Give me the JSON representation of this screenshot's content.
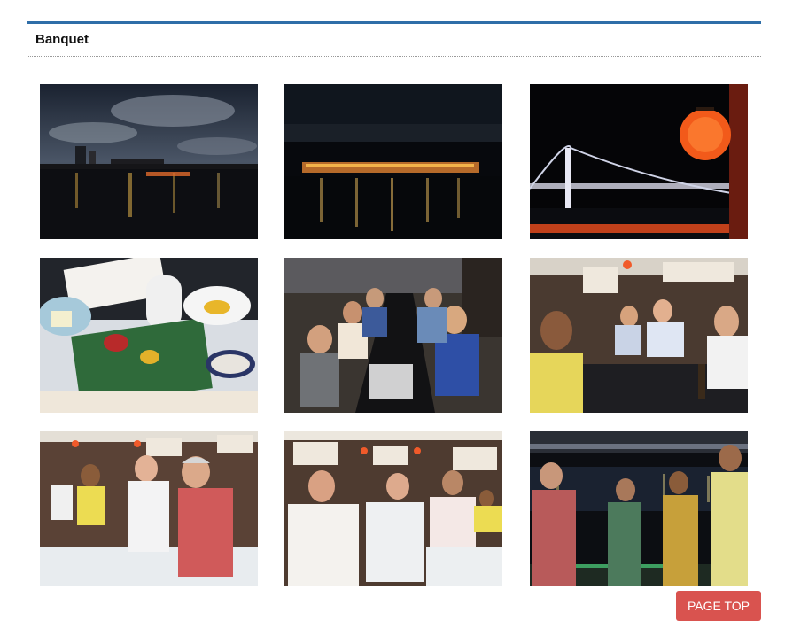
{
  "section": {
    "title": "Banquet"
  },
  "gallery": {
    "photos": [
      {
        "subject": "night-skyline-over-water"
      },
      {
        "subject": "illuminated-boat-at-night"
      },
      {
        "subject": "red-lantern-and-bridge-at-night"
      },
      {
        "subject": "japanese-dinner-tray"
      },
      {
        "subject": "guests-at-long-dinner-table"
      },
      {
        "subject": "guests-seated-at-table"
      },
      {
        "subject": "guests-posing-at-banquet"
      },
      {
        "subject": "guests-seated-at-banquet"
      },
      {
        "subject": "guests-on-boat-deck-at-night"
      }
    ]
  },
  "page_top": {
    "label": "PAGE TOP"
  },
  "colors": {
    "accent_rule": "#2f6ea8",
    "page_top_button": "#d9534f"
  }
}
